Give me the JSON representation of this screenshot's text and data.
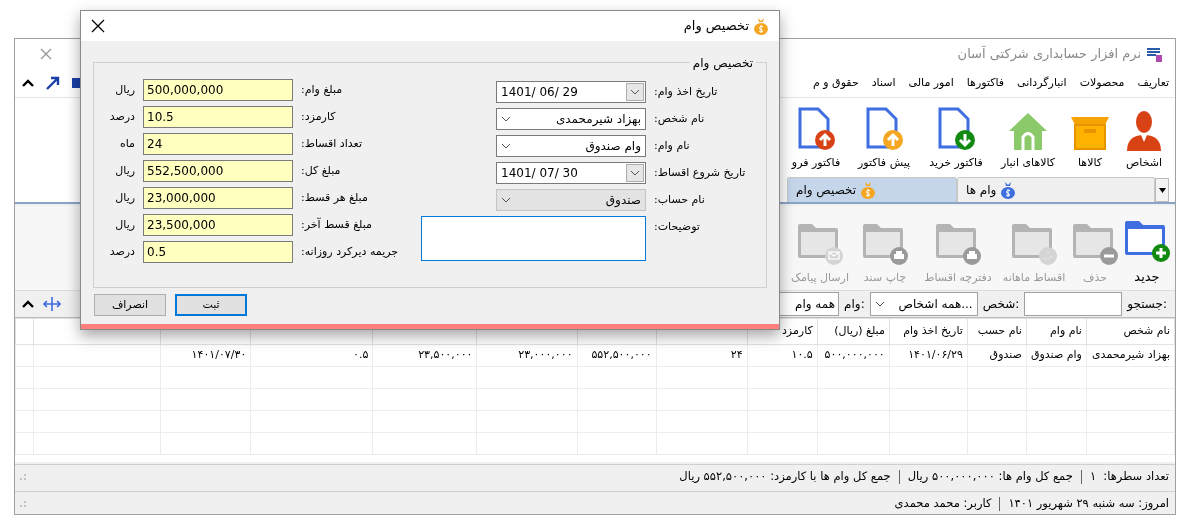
{
  "main_window": {
    "title": "نرم افزار حسابداری شرکتی آسان",
    "menu": [
      "تعاریف",
      "محصولات",
      "انبارگردانی",
      "فاکتورها",
      "امور مالی",
      "اسناد",
      "حقوق و م"
    ],
    "toolbar": [
      "اشخاص",
      "کالاها",
      "کالاهای انبار",
      "فاکتور خرید",
      "پیش فاکتور",
      "فاکتور فرو"
    ],
    "tabs": [
      {
        "label": "وام ها",
        "selected": false
      },
      {
        "label": "تخصیص وام",
        "selected": true
      }
    ],
    "actions": [
      {
        "label": "جدید",
        "disabled": false
      },
      {
        "label": "حذف",
        "disabled": true
      },
      {
        "label": "اقساط ماهانه",
        "disabled": true
      },
      {
        "label": "دفترچه اقساط",
        "disabled": true
      },
      {
        "label": "چاپ سند",
        "disabled": true
      },
      {
        "label": "ارسال پیامک",
        "disabled": true
      }
    ],
    "filters": {
      "search_label": "جستجو:",
      "person_label": "شخص:",
      "person_value": "همه اشخاص...",
      "loan_label": "وام:",
      "loan_value": "همه وام"
    },
    "table": {
      "columns": [
        "نام شخص",
        "نام وام",
        "نام حسب",
        "تاریخ اخذ وام",
        "مبلغ (ریال)",
        "کارمزد"
      ],
      "rows": [
        [
          "بهزاد شیرمحمدی",
          "وام صندوق",
          "صندوق",
          "۱۴۰۱/۰۶/۲۹",
          "۵۰۰,۰۰۰,۰۰۰",
          "۱۰.۵",
          "۲۴",
          "۵۵۲,۵۰۰,۰۰۰",
          "۲۳,۰۰۰,۰۰۰",
          "۲۳,۵۰۰,۰۰۰",
          "۰.۵",
          "۱۴۰۱/۰۷/۳۰",
          ""
        ]
      ]
    },
    "status_bar": [
      "تعداد سطرها:  ۱",
      "جمع کل وام ها: ۵۰۰,۰۰۰,۰۰۰ ریال",
      "جمع کل وام ها با کارمزد: ۵۵۲,۵۰۰,۰۰۰ ریال"
    ],
    "footer": [
      "امروز: سه شنبه ۲۹ شهریور ۱۴۰۱",
      "کاربر: محمد محمدی"
    ]
  },
  "dialog": {
    "title": "تخصیص وام",
    "group_title": "تخصیص وام",
    "right_fields": [
      {
        "label": "تاریخ اخذ وام:",
        "value": "1401/ 06/ 29",
        "kind": "date",
        "disabled": false
      },
      {
        "label": "نام شخص:",
        "value": "بهزاد شیرمحمدی",
        "kind": "combo",
        "disabled": false
      },
      {
        "label": "نام وام:",
        "value": "وام صندوق",
        "kind": "combo",
        "disabled": false
      },
      {
        "label": "تاریخ شروع اقساط:",
        "value": "1401/ 07/ 30",
        "kind": "date",
        "disabled": false
      },
      {
        "label": "نام حساب:",
        "value": "صندوق",
        "kind": "combo",
        "disabled": true
      },
      {
        "label": "توضیحات:",
        "kind": "memo",
        "disabled": false
      }
    ],
    "left_fields": [
      {
        "label": "مبلغ وام:",
        "value": "500,000,000",
        "unit": "ریال"
      },
      {
        "label": "کارمزد:",
        "value": "10.5",
        "unit": "درصد"
      },
      {
        "label": "تعداد اقساط:",
        "value": "24",
        "unit": "ماه"
      },
      {
        "label": "مبلغ کل:",
        "value": "552,500,000",
        "unit": "ریال"
      },
      {
        "label": "مبلغ هر قسط:",
        "value": "23,000,000",
        "unit": "ریال"
      },
      {
        "label": "مبلغ قسط آخر:",
        "value": "23,500,000",
        "unit": "ریال"
      },
      {
        "label": "جریمه دیرکرد روزانه:",
        "value": "0.5",
        "unit": "درصد"
      }
    ],
    "buttons": [
      {
        "label": "ثبت",
        "focused": true
      },
      {
        "label": "انصراف",
        "focused": false
      }
    ]
  }
}
